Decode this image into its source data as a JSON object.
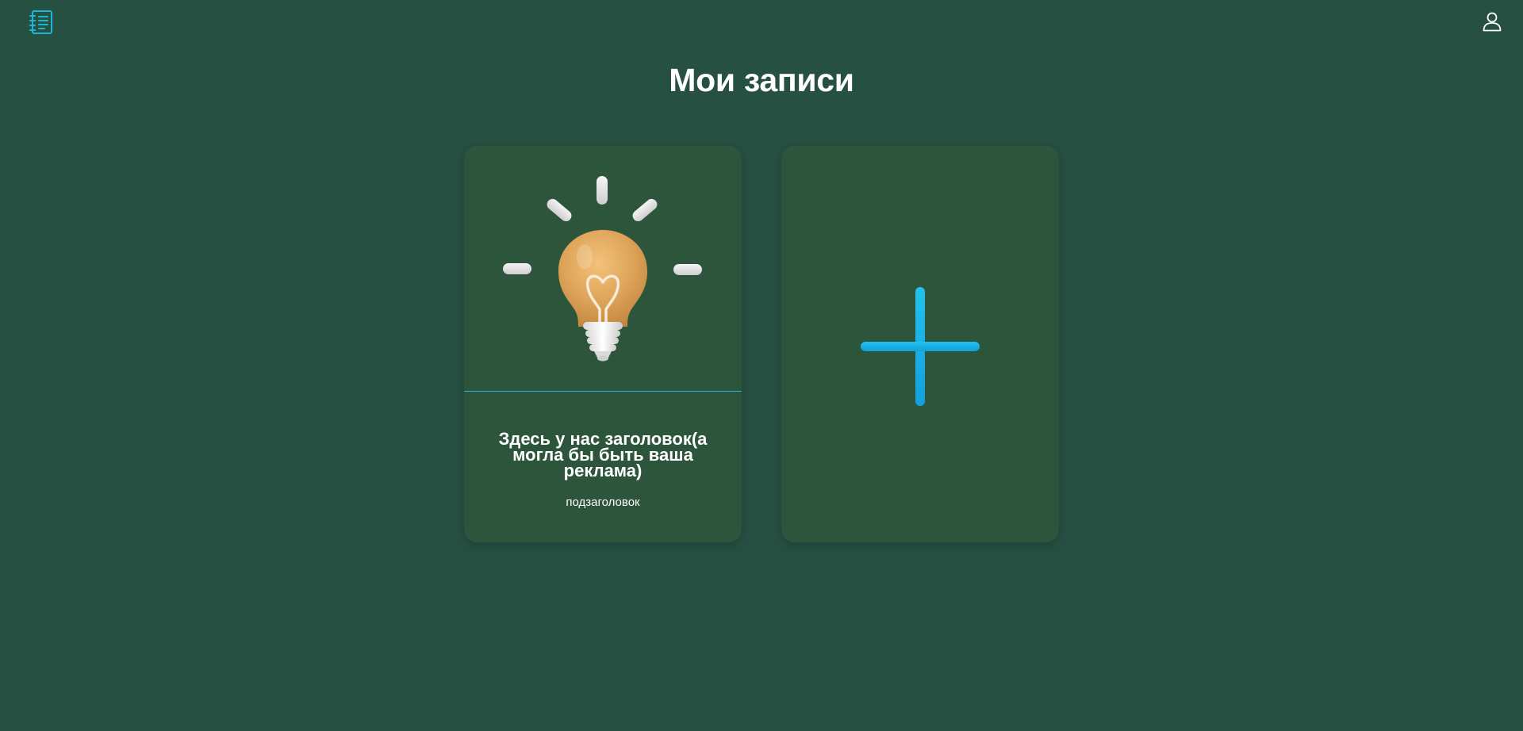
{
  "header": {
    "logo_icon": "notebook-list-icon",
    "user_icon": "user-profile-icon"
  },
  "page": {
    "title": "Мои записи"
  },
  "notes": [
    {
      "image_icon": "light-bulb-illustration",
      "title": "Здесь у нас заголовок(а могла бы быть ваша реклама)",
      "subtitle": "подзаголовок"
    }
  ],
  "add_card": {
    "icon": "plus-icon"
  },
  "colors": {
    "background": "#265042",
    "card": "#2d553c",
    "accent": "#1fb5d9",
    "text": "#ffffff"
  }
}
